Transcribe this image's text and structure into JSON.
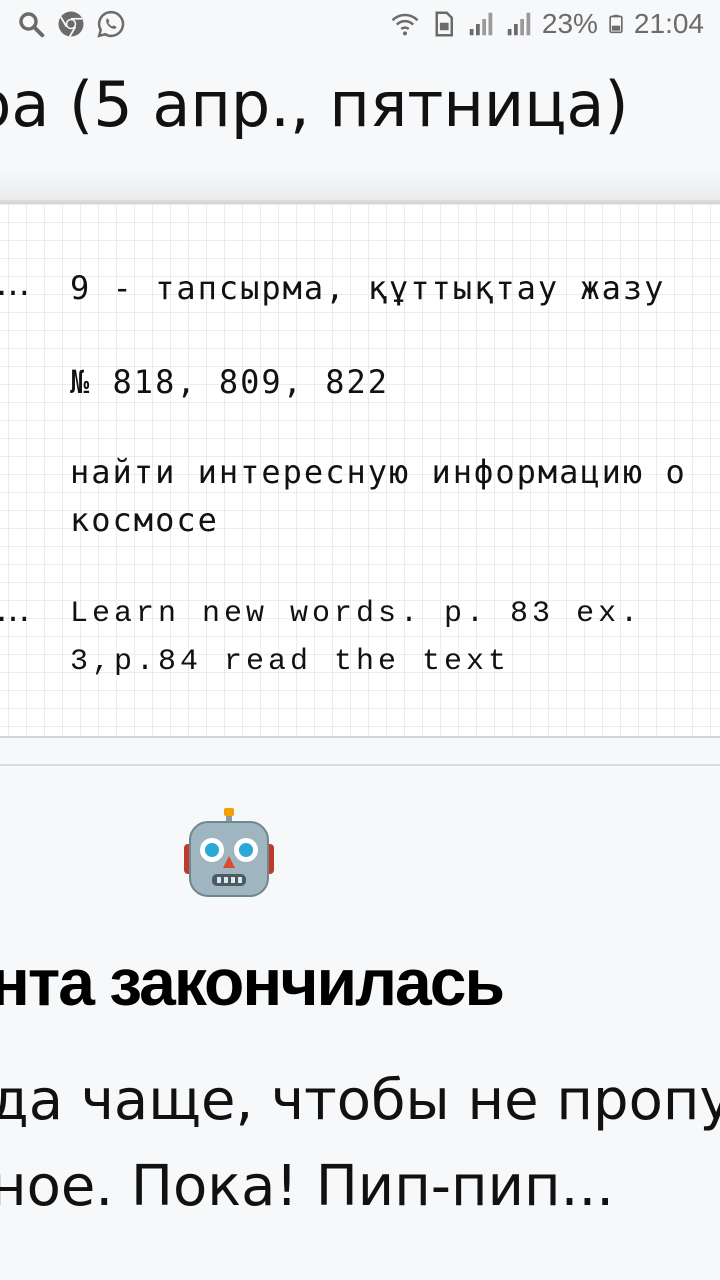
{
  "status_bar": {
    "icons_left": [
      "search-icon",
      "chrome-icon",
      "whatsapp-icon"
    ],
    "icons_right": [
      "wifi-icon",
      "sim-icon",
      "signal-icon",
      "signal-icon",
      "battery-icon"
    ],
    "battery": "23%",
    "time": "21:04"
  },
  "header": {
    "title": "ра (5 апр., пятница)"
  },
  "homework": {
    "rows": [
      {
        "prefix": "…",
        "text": "9 - тапсырма, құттықтау жазу"
      },
      {
        "prefix": "",
        "text": "№ 818, 809, 822"
      },
      {
        "prefix": "",
        "text": "найти интересную информацию о космосе"
      },
      {
        "prefix": "…",
        "text": "Learn new words. p. 83 ex. 3,p.84 read the text"
      }
    ]
  },
  "end": {
    "icon": "robot-icon",
    "title": "нта закончилась",
    "line1": "да чаще, чтобы не пропу",
    "line2": "ное. Пока! Пип-пип..."
  },
  "colors": {
    "background": "#f7f8fa",
    "card_grid": "#ececec",
    "text": "#111111",
    "status_icons": "#6b6b6b"
  }
}
